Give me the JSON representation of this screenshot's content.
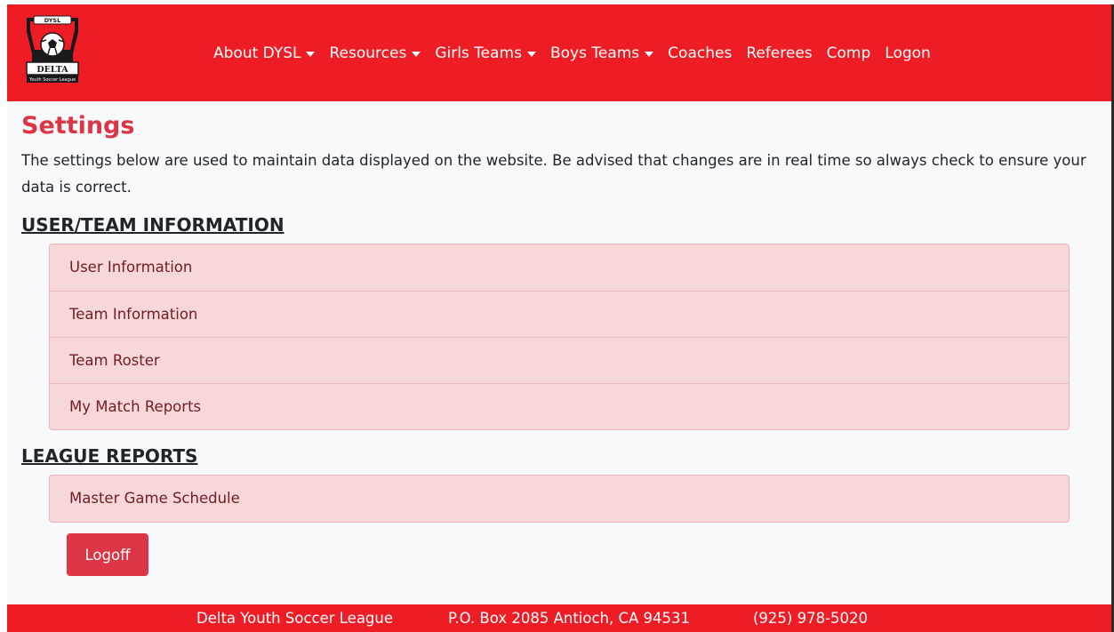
{
  "colors": {
    "brand_red": "#ee1c25",
    "title_red": "#dc3545",
    "list_bg": "#f8d7da",
    "list_text": "#721c24",
    "page_bg": "#f8f9fa"
  },
  "logo": {
    "top_text": "DYSL",
    "banner_text": "DELTA",
    "sub_text": "Youth Soccer League"
  },
  "nav": {
    "items": [
      {
        "label": "About DYSL",
        "dropdown": true
      },
      {
        "label": "Resources",
        "dropdown": true
      },
      {
        "label": "Girls Teams",
        "dropdown": true
      },
      {
        "label": "Boys Teams",
        "dropdown": true
      },
      {
        "label": "Coaches",
        "dropdown": false
      },
      {
        "label": "Referees",
        "dropdown": false
      },
      {
        "label": "Comp",
        "dropdown": false
      },
      {
        "label": "Logon",
        "dropdown": false
      }
    ]
  },
  "page": {
    "title": "Settings",
    "description": "The settings below are used to maintain data displayed on the website. Be advised that changes are in real time so always check to ensure your data is correct."
  },
  "sections": {
    "user_team": {
      "title": "USER/TEAM INFORMATION",
      "items": [
        "User Information",
        "Team Information",
        "Team Roster",
        "My Match Reports"
      ]
    },
    "league_reports": {
      "title": "LEAGUE REPORTS",
      "items": [
        "Master Game Schedule"
      ]
    }
  },
  "buttons": {
    "logoff": "Logoff"
  },
  "footer": {
    "org": "Delta Youth Soccer League",
    "address": "P.O. Box 2085 Antioch, CA 94531",
    "phone": "(925) 978-5020"
  }
}
